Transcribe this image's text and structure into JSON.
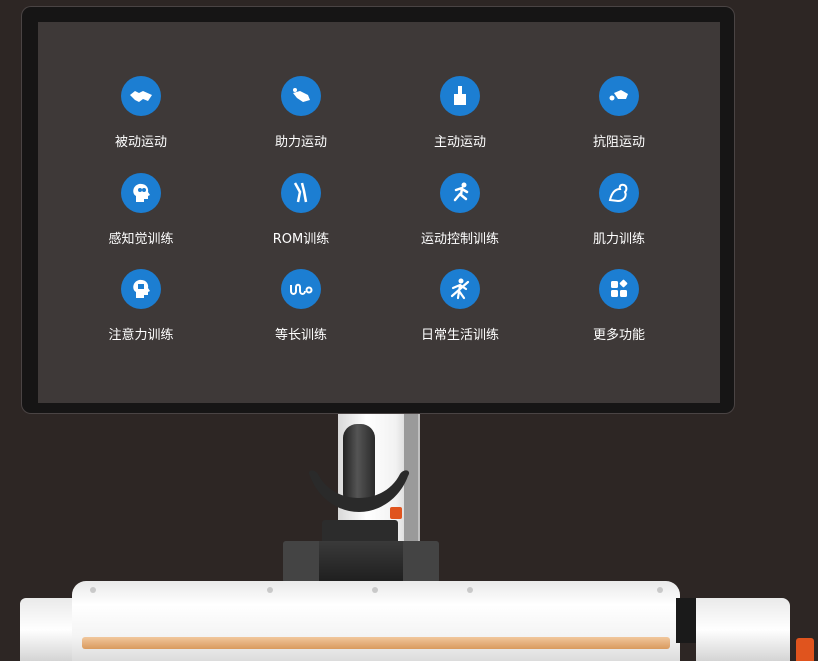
{
  "menu": {
    "items": [
      {
        "label": "被动运动",
        "icon": "handshake-icon"
      },
      {
        "label": "助力运动",
        "icon": "assist-hand-icon"
      },
      {
        "label": "主动运动",
        "icon": "raised-hand-icon"
      },
      {
        "label": "抗阻运动",
        "icon": "resistance-hand-icon"
      },
      {
        "label": "感知觉训练",
        "icon": "perception-head-icon"
      },
      {
        "label": "ROM训练",
        "icon": "joint-bone-icon"
      },
      {
        "label": "运动控制训练",
        "icon": "running-person-icon"
      },
      {
        "label": "肌力训练",
        "icon": "flexed-arm-icon"
      },
      {
        "label": "注意力训练",
        "icon": "attention-head-icon"
      },
      {
        "label": "等长训练",
        "icon": "isometric-wave-icon"
      },
      {
        "label": "日常生活训练",
        "icon": "daily-activity-person-icon"
      },
      {
        "label": "更多功能",
        "icon": "more-functions-grid-icon"
      }
    ]
  },
  "colors": {
    "screen_bg": "#3e3938",
    "icon_bg": "#1c7ed2",
    "label_text": "#ffffff",
    "accent_orange": "#e0541e"
  }
}
